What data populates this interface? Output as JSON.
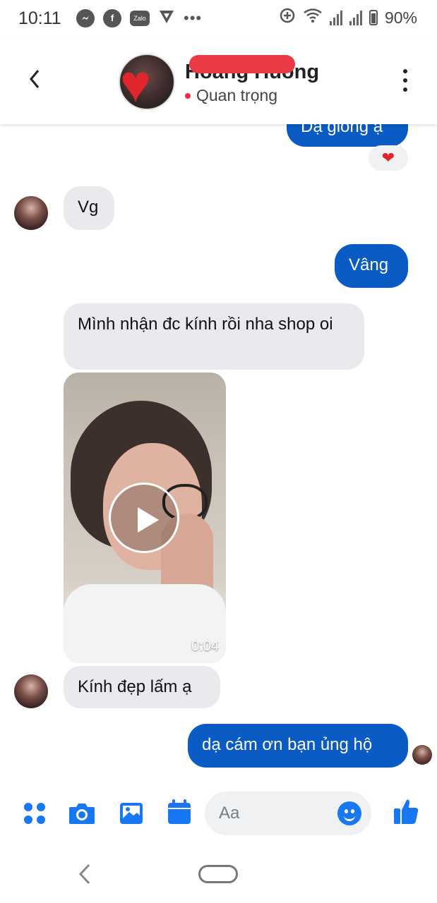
{
  "status_bar": {
    "time": "10:11",
    "notification_icons": [
      "messenger-icon",
      "facebook-icon",
      "zalo-icon",
      "vpn-shield-icon"
    ],
    "zalo_label": "Zalo",
    "battery": "90%"
  },
  "header": {
    "contact_name": "Hoang Huong",
    "status_label": "Quan trọng",
    "status_color": "#f02849"
  },
  "messages": {
    "sent_top": "Dạ giống ạ",
    "reaction": "❤",
    "received_1": "Vg",
    "sent_1": "Vâng",
    "received_2": "Mình nhận đc kính rồi nha shop oi",
    "video_duration": "0:04",
    "received_3": "Kính đẹp lấm ạ",
    "sent_2": "dạ cám ơn bạn ủng hộ"
  },
  "composer": {
    "placeholder": "Aa",
    "accent_color": "#1877f2"
  },
  "colors": {
    "sent_bubble": "#0a5bc4",
    "received_bubble": "#e9eaed"
  }
}
